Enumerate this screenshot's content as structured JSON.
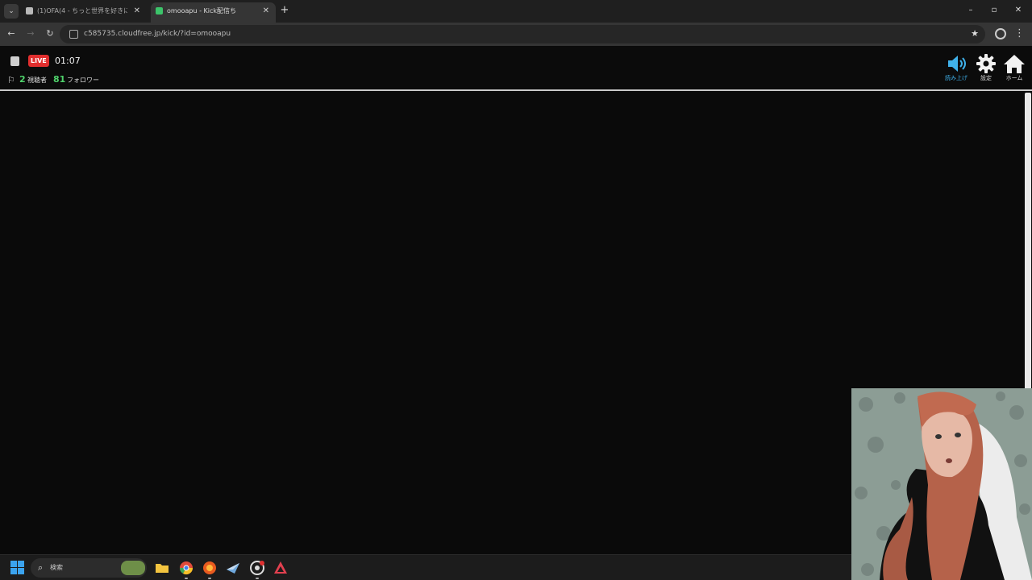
{
  "browser": {
    "tabs": [
      {
        "title": "(1)OFA(4 - ちっと世界を好きに",
        "active": false
      },
      {
        "title": "omooapu - Kick配信ち",
        "active": true
      }
    ],
    "new_tab_symbol": "+",
    "url": "c585735.cloudfree.jp/kick/?id=omooapu",
    "window_controls": {
      "minimize": "–",
      "maximize": "▫",
      "close": "✕"
    }
  },
  "stream": {
    "live_label": "LIVE",
    "elapsed_time": "01:07",
    "viewer_count": "2",
    "viewer_label": "視聴者",
    "follower_count": "81",
    "follower_label": "フォロワー",
    "buttons": {
      "read_aloud": "読み上げ",
      "settings": "設定",
      "home": "ホーム"
    },
    "accent_color": "#3fb1ea",
    "live_color": "#e12e2e",
    "count_color": "#4fd26b"
  },
  "taskbar": {
    "search_placeholder": "検索",
    "apps": [
      "file-explorer-icon",
      "chrome-icon",
      "firefox-icon",
      "steam-icon",
      "obs-icon",
      "app-icon"
    ]
  }
}
